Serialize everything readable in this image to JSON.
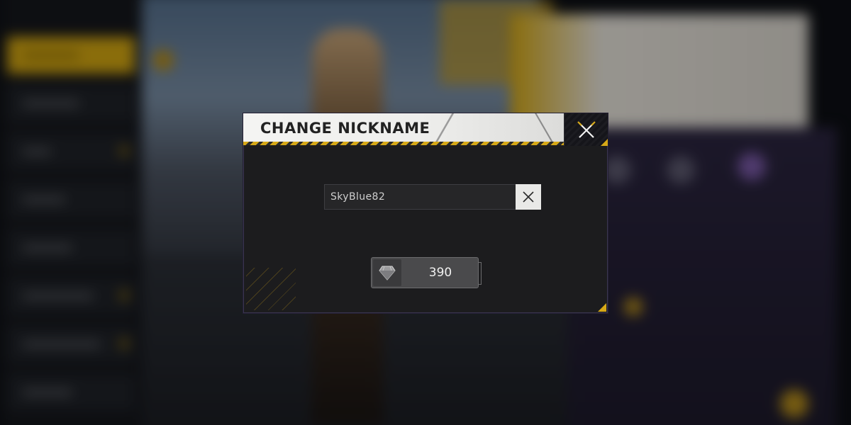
{
  "dialog": {
    "title": "CHANGE NICKNAME",
    "close_icon": "close-x-icon",
    "accent_color": "#d6a817"
  },
  "nickname_input": {
    "value": "SkyBlue82",
    "clear_icon": "clear-x-icon"
  },
  "cost_button": {
    "currency_icon": "diamond-icon",
    "value": "390"
  }
}
